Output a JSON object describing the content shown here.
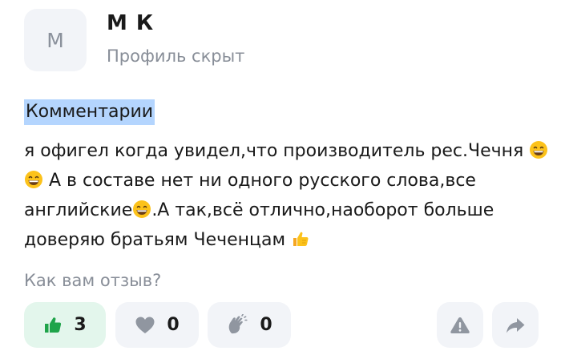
{
  "author": {
    "avatar_letter": "М",
    "name": "М К",
    "subtitle": "Профиль скрыт"
  },
  "comments": {
    "title": "Комментарии",
    "lines": [
      {
        "before": "я офигел когда увидел,что производитель рес.Чечня",
        "after": ""
      },
      {
        "before": "",
        "after": " А в составе нет ни одного русского слова,все"
      },
      {
        "before": "английские",
        "after": ".А так,всё отлично,наоборот больше"
      },
      {
        "before": "доверяю братьям Чеченцам ",
        "after": ""
      }
    ]
  },
  "feedback": {
    "question": "Как вам отзыв?",
    "reactions": [
      {
        "icon": "thumbs-up-icon",
        "count": "3"
      },
      {
        "icon": "heart-icon",
        "count": "0"
      },
      {
        "icon": "clapping-hands-icon",
        "count": "0"
      }
    ],
    "actions": [
      {
        "icon": "warning-icon"
      },
      {
        "icon": "share-arrow-icon"
      }
    ]
  },
  "colors": {
    "like_active_bg": "#e3f6ec",
    "like_active_icon": "#1fa44a",
    "chip_bg": "#f2f4f8",
    "icon_gray": "#9096a0",
    "muted_text": "#888e98",
    "highlight": "#b4d5fe"
  }
}
